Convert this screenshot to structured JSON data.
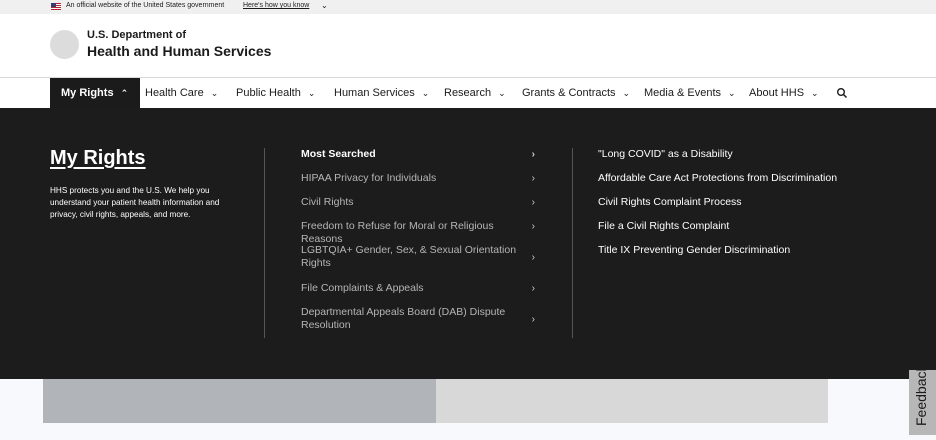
{
  "gov_banner": {
    "official_text": "An official website of the United States government",
    "howto_link": "Here's how you know"
  },
  "header": {
    "title_line1": "U.S. Department of",
    "title_line2": "Health and Human Services"
  },
  "nav": {
    "items": [
      {
        "label": "My Rights",
        "active": true
      },
      {
        "label": "Health Care"
      },
      {
        "label": "Public Health"
      },
      {
        "label": "Human Services"
      },
      {
        "label": "Research"
      },
      {
        "label": "Grants & Contracts"
      },
      {
        "label": "Media & Events"
      },
      {
        "label": "About HHS"
      }
    ]
  },
  "mega_menu": {
    "title": "My Rights",
    "description": "HHS protects you and the U.S. We help you understand your patient health information and privacy, civil rights, appeals, and more.",
    "column2": [
      {
        "label": "Most Searched",
        "header": true
      },
      {
        "label": "HIPAA Privacy for Individuals"
      },
      {
        "label": "Civil Rights"
      },
      {
        "label": "Freedom to Refuse for Moral or Religious Reasons"
      },
      {
        "label": "LGBTQIA+ Gender, Sex, & Sexual Orientation Rights"
      },
      {
        "label": "File Complaints & Appeals"
      },
      {
        "label": "Departmental Appeals Board (DAB) Dispute Resolution"
      }
    ],
    "column3": [
      {
        "label": "\"Long COVID\" as a Disability"
      },
      {
        "label": "Affordable Care Act Protections from Discrimination"
      },
      {
        "label": "Civil Rights Complaint Process"
      },
      {
        "label": "File a Civil Rights Complaint"
      },
      {
        "label": "Title IX Preventing Gender Discrimination"
      }
    ]
  },
  "feedback": {
    "label": "Feedback"
  },
  "icons": {
    "caret": "chevron-down-icon",
    "search": "search-icon",
    "arrow": "chevron-right-icon"
  },
  "colors": {
    "nav_active_bg": "#1b1b1b",
    "mega_bg": "#1c1c1c",
    "banner_bg": "#f0f0f0"
  }
}
